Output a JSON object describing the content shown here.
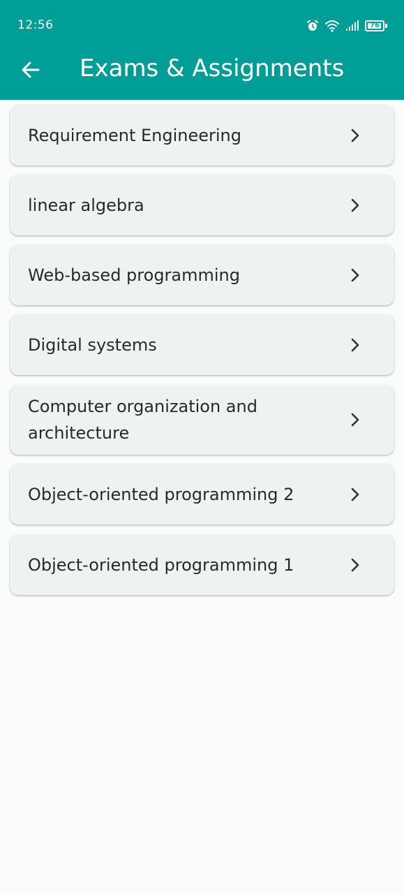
{
  "status_bar": {
    "time": "12:56",
    "battery_level": "76",
    "icons": [
      "alarm-icon",
      "wifi-icon",
      "signal-icon",
      "battery-icon"
    ]
  },
  "app_bar": {
    "title": "Exams & Assignments",
    "back_icon": "arrow-left-icon",
    "background_color": "#009e96"
  },
  "subjects": [
    {
      "label": "Requirement Engineering"
    },
    {
      "label": "linear algebra"
    },
    {
      "label": "Web-based programming"
    },
    {
      "label": "Digital systems"
    },
    {
      "label": "Computer organization and architecture"
    },
    {
      "label": "Object-oriented programming 2"
    },
    {
      "label": "Object-oriented programming 1"
    }
  ]
}
